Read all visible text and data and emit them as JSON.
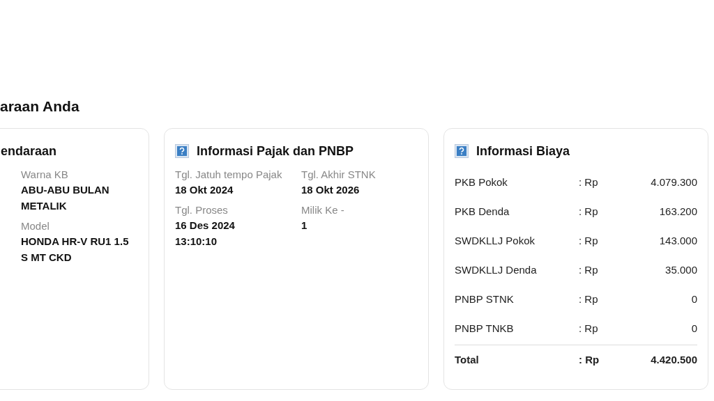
{
  "page_title": "araan Anda",
  "vehicle_card": {
    "title": "endaraan",
    "fields": [
      {
        "label": "Warna KB",
        "value": "ABU-ABU BULAN METALIK"
      },
      {
        "label": "Model",
        "value": "HONDA HR-V RU1 1.5 S MT CKD"
      }
    ]
  },
  "tax_card": {
    "title": "Informasi Pajak dan PNBP",
    "fields": [
      {
        "label": "Tgl. Jatuh tempo Pajak",
        "value": "18 Okt 2024"
      },
      {
        "label": "Tgl. Akhir STNK",
        "value": "18 Okt 2026"
      },
      {
        "label": "Tgl. Proses",
        "value": "16 Des 2024 13:10:10"
      },
      {
        "label": "Milik Ke -",
        "value": "1"
      }
    ]
  },
  "cost_card": {
    "title": "Informasi Biaya",
    "rows": [
      {
        "label": "PKB Pokok",
        "currency": ": Rp",
        "amount": "4.079.300"
      },
      {
        "label": "PKB Denda",
        "currency": ": Rp",
        "amount": "163.200"
      },
      {
        "label": "SWDKLLJ Pokok",
        "currency": ": Rp",
        "amount": "143.000"
      },
      {
        "label": "SWDKLLJ Denda",
        "currency": ": Rp",
        "amount": "35.000"
      },
      {
        "label": "PNBP STNK",
        "currency": ": Rp",
        "amount": "0"
      },
      {
        "label": "PNBP TNKB",
        "currency": ": Rp",
        "amount": "0"
      }
    ],
    "total": {
      "label": "Total",
      "currency": ": Rp",
      "amount": "4.420.500"
    }
  }
}
